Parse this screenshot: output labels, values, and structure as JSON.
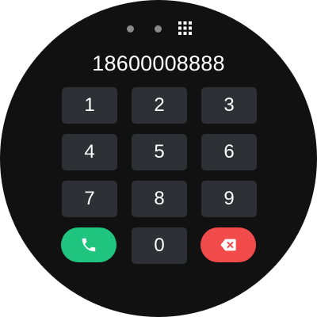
{
  "pager": {
    "page_count": 2,
    "grid_icon": "grid-icon"
  },
  "dialer": {
    "number": "18600008888",
    "keys": [
      "1",
      "2",
      "3",
      "4",
      "5",
      "6",
      "7",
      "8",
      "9",
      "0"
    ]
  },
  "actions": {
    "call_icon": "phone-icon",
    "delete_icon": "backspace-icon"
  },
  "colors": {
    "background": "#111111",
    "key": "#2e3036",
    "call": "#1fc47f",
    "delete": "#f24b4b"
  }
}
